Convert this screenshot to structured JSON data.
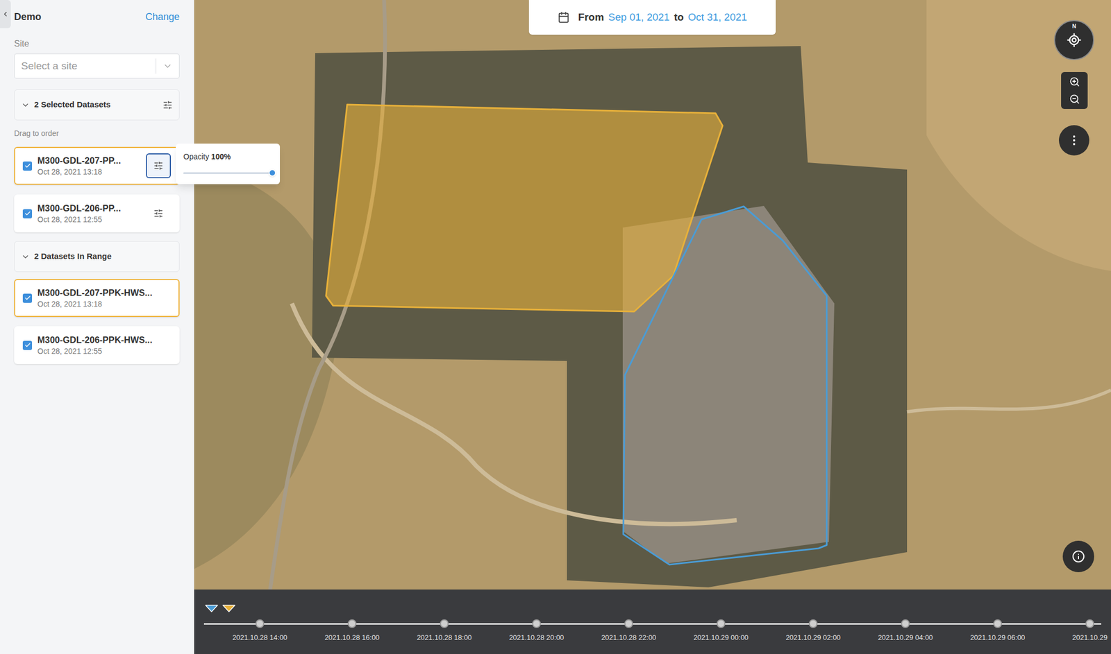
{
  "sidebar": {
    "title": "Demo",
    "change": "Change",
    "site_label": "Site",
    "site_select": {
      "placeholder": "Select a site"
    },
    "selected_section": {
      "label": "2 Selected Datasets",
      "expanded": true
    },
    "hint": "Drag to order",
    "selected_datasets": [
      {
        "name": "M300-GDL-207-PP...",
        "date": "Oct 28, 2021 13:18",
        "checked": true,
        "selected": true,
        "settings_open": true
      },
      {
        "name": "M300-GDL-206-PP...",
        "date": "Oct 28, 2021 12:55",
        "checked": true,
        "selected": false,
        "settings_open": false
      }
    ],
    "opacity_popover": {
      "label": "Opacity",
      "value": "100%",
      "level": 1
    },
    "range_section": {
      "label": "2 Datasets In Range",
      "expanded": true
    },
    "range_datasets": [
      {
        "name": "M300-GDL-207-PPK-HWS...",
        "date": "Oct 28, 2021 13:18",
        "checked": true,
        "selected": true
      },
      {
        "name": "M300-GDL-206-PPK-HWS...",
        "date": "Oct 28, 2021 12:55",
        "checked": true,
        "selected": false
      }
    ]
  },
  "date_range": {
    "from_label": "From",
    "from": "Sep 01, 2021",
    "to_label": "to",
    "to": "Oct 31, 2021"
  },
  "map": {
    "compass": "N",
    "areas": [
      {
        "color": "#e8b13a",
        "filled": true
      },
      {
        "color": "#4a9cd6",
        "filled": false
      }
    ]
  },
  "timeline": {
    "markers": [
      {
        "color": "#4a9cd6"
      },
      {
        "color": "#e8b13a"
      }
    ],
    "ticks": [
      "2021.10.28 14:00",
      "2021.10.28 16:00",
      "2021.10.28 18:00",
      "2021.10.28 20:00",
      "2021.10.28 22:00",
      "2021.10.29 00:00",
      "2021.10.29 02:00",
      "2021.10.29 04:00",
      "2021.10.29 06:00",
      "2021.10.29"
    ]
  }
}
